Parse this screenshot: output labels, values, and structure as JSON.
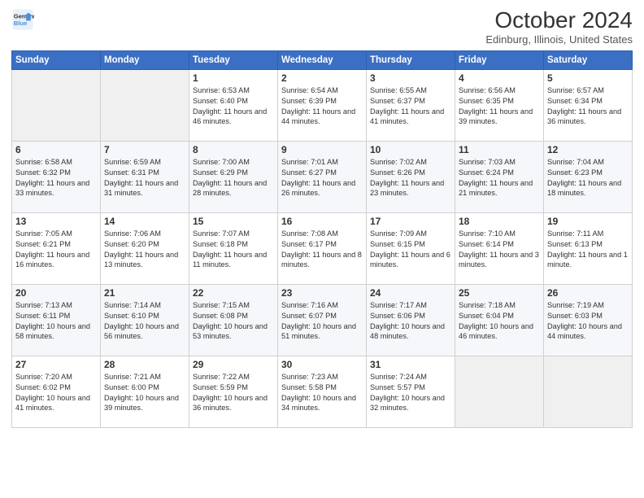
{
  "header": {
    "logo_line1": "General",
    "logo_line2": "Blue",
    "month": "October 2024",
    "location": "Edinburg, Illinois, United States"
  },
  "weekdays": [
    "Sunday",
    "Monday",
    "Tuesday",
    "Wednesday",
    "Thursday",
    "Friday",
    "Saturday"
  ],
  "weeks": [
    [
      {
        "day": "",
        "empty": true
      },
      {
        "day": "",
        "empty": true
      },
      {
        "day": "1",
        "sunrise": "6:53 AM",
        "sunset": "6:40 PM",
        "daylight": "11 hours and 46 minutes."
      },
      {
        "day": "2",
        "sunrise": "6:54 AM",
        "sunset": "6:39 PM",
        "daylight": "11 hours and 44 minutes."
      },
      {
        "day": "3",
        "sunrise": "6:55 AM",
        "sunset": "6:37 PM",
        "daylight": "11 hours and 41 minutes."
      },
      {
        "day": "4",
        "sunrise": "6:56 AM",
        "sunset": "6:35 PM",
        "daylight": "11 hours and 39 minutes."
      },
      {
        "day": "5",
        "sunrise": "6:57 AM",
        "sunset": "6:34 PM",
        "daylight": "11 hours and 36 minutes."
      }
    ],
    [
      {
        "day": "6",
        "sunrise": "6:58 AM",
        "sunset": "6:32 PM",
        "daylight": "11 hours and 33 minutes."
      },
      {
        "day": "7",
        "sunrise": "6:59 AM",
        "sunset": "6:31 PM",
        "daylight": "11 hours and 31 minutes."
      },
      {
        "day": "8",
        "sunrise": "7:00 AM",
        "sunset": "6:29 PM",
        "daylight": "11 hours and 28 minutes."
      },
      {
        "day": "9",
        "sunrise": "7:01 AM",
        "sunset": "6:27 PM",
        "daylight": "11 hours and 26 minutes."
      },
      {
        "day": "10",
        "sunrise": "7:02 AM",
        "sunset": "6:26 PM",
        "daylight": "11 hours and 23 minutes."
      },
      {
        "day": "11",
        "sunrise": "7:03 AM",
        "sunset": "6:24 PM",
        "daylight": "11 hours and 21 minutes."
      },
      {
        "day": "12",
        "sunrise": "7:04 AM",
        "sunset": "6:23 PM",
        "daylight": "11 hours and 18 minutes."
      }
    ],
    [
      {
        "day": "13",
        "sunrise": "7:05 AM",
        "sunset": "6:21 PM",
        "daylight": "11 hours and 16 minutes."
      },
      {
        "day": "14",
        "sunrise": "7:06 AM",
        "sunset": "6:20 PM",
        "daylight": "11 hours and 13 minutes."
      },
      {
        "day": "15",
        "sunrise": "7:07 AM",
        "sunset": "6:18 PM",
        "daylight": "11 hours and 11 minutes."
      },
      {
        "day": "16",
        "sunrise": "7:08 AM",
        "sunset": "6:17 PM",
        "daylight": "11 hours and 8 minutes."
      },
      {
        "day": "17",
        "sunrise": "7:09 AM",
        "sunset": "6:15 PM",
        "daylight": "11 hours and 6 minutes."
      },
      {
        "day": "18",
        "sunrise": "7:10 AM",
        "sunset": "6:14 PM",
        "daylight": "11 hours and 3 minutes."
      },
      {
        "day": "19",
        "sunrise": "7:11 AM",
        "sunset": "6:13 PM",
        "daylight": "11 hours and 1 minute."
      }
    ],
    [
      {
        "day": "20",
        "sunrise": "7:13 AM",
        "sunset": "6:11 PM",
        "daylight": "10 hours and 58 minutes."
      },
      {
        "day": "21",
        "sunrise": "7:14 AM",
        "sunset": "6:10 PM",
        "daylight": "10 hours and 56 minutes."
      },
      {
        "day": "22",
        "sunrise": "7:15 AM",
        "sunset": "6:08 PM",
        "daylight": "10 hours and 53 minutes."
      },
      {
        "day": "23",
        "sunrise": "7:16 AM",
        "sunset": "6:07 PM",
        "daylight": "10 hours and 51 minutes."
      },
      {
        "day": "24",
        "sunrise": "7:17 AM",
        "sunset": "6:06 PM",
        "daylight": "10 hours and 48 minutes."
      },
      {
        "day": "25",
        "sunrise": "7:18 AM",
        "sunset": "6:04 PM",
        "daylight": "10 hours and 46 minutes."
      },
      {
        "day": "26",
        "sunrise": "7:19 AM",
        "sunset": "6:03 PM",
        "daylight": "10 hours and 44 minutes."
      }
    ],
    [
      {
        "day": "27",
        "sunrise": "7:20 AM",
        "sunset": "6:02 PM",
        "daylight": "10 hours and 41 minutes."
      },
      {
        "day": "28",
        "sunrise": "7:21 AM",
        "sunset": "6:00 PM",
        "daylight": "10 hours and 39 minutes."
      },
      {
        "day": "29",
        "sunrise": "7:22 AM",
        "sunset": "5:59 PM",
        "daylight": "10 hours and 36 minutes."
      },
      {
        "day": "30",
        "sunrise": "7:23 AM",
        "sunset": "5:58 PM",
        "daylight": "10 hours and 34 minutes."
      },
      {
        "day": "31",
        "sunrise": "7:24 AM",
        "sunset": "5:57 PM",
        "daylight": "10 hours and 32 minutes."
      },
      {
        "day": "",
        "empty": true
      },
      {
        "day": "",
        "empty": true
      }
    ]
  ]
}
